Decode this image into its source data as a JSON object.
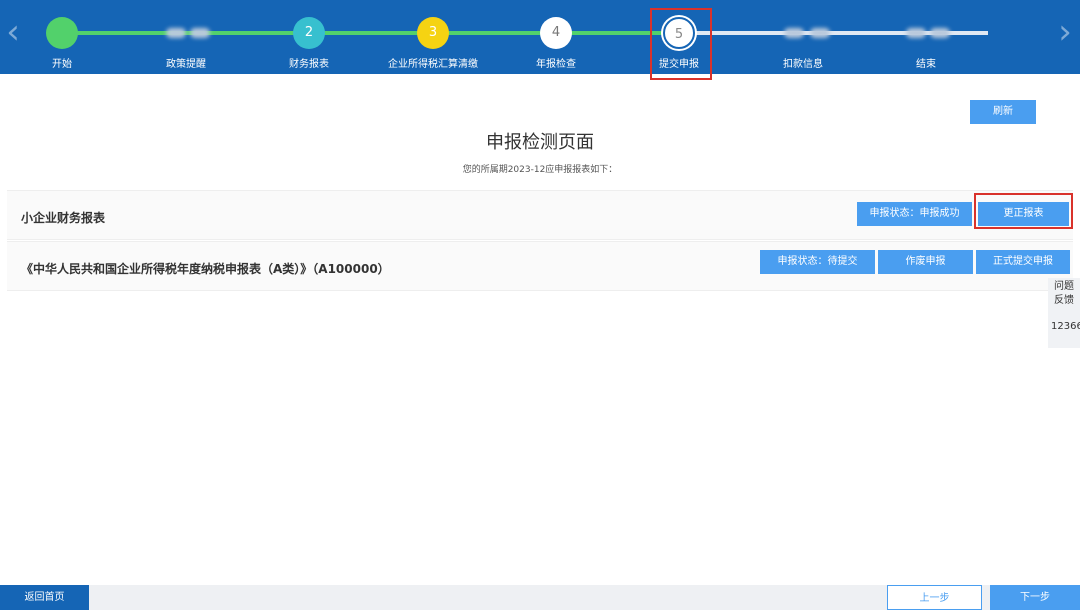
{
  "steps": [
    {
      "number": "",
      "label": "开始"
    },
    {
      "number": "",
      "label": "政策提醒"
    },
    {
      "number": "2",
      "label": "财务报表"
    },
    {
      "number": "3",
      "label": "企业所得税汇算清缴"
    },
    {
      "number": "4",
      "label": "年报检查"
    },
    {
      "number": "5",
      "label": "提交申报"
    },
    {
      "number": "",
      "label": "扣款信息"
    },
    {
      "number": "",
      "label": "结束"
    }
  ],
  "nav": {
    "prev_icon": "‹",
    "next_icon": "›"
  },
  "page": {
    "refresh_label": "刷新",
    "title": "申报检测页面",
    "subtitle": "您的所属期2023-12应申报报表如下："
  },
  "reports": [
    {
      "name": "小企业财务报表",
      "status_label": "申报状态：申报成功",
      "action_label": "更正报表"
    },
    {
      "name": "《中华人民共和国企业所得税年度纳税申报表（A类）》（A100000）",
      "status_label": "申报状态：待提交",
      "void_label": "作废申报",
      "submit_label": "正式提交申报"
    }
  ],
  "feedback": {
    "label_line1": "问题",
    "label_line2": "反馈",
    "hotline": "12366"
  },
  "bottom": {
    "home_label": "返回首页",
    "prev_label": "上一步",
    "next_label": "下一步"
  },
  "colors": {
    "header_blue": "#1565b5",
    "button_blue": "#4a9ef0",
    "progress_green": "#52d16b",
    "highlight_red": "#d9322b"
  }
}
